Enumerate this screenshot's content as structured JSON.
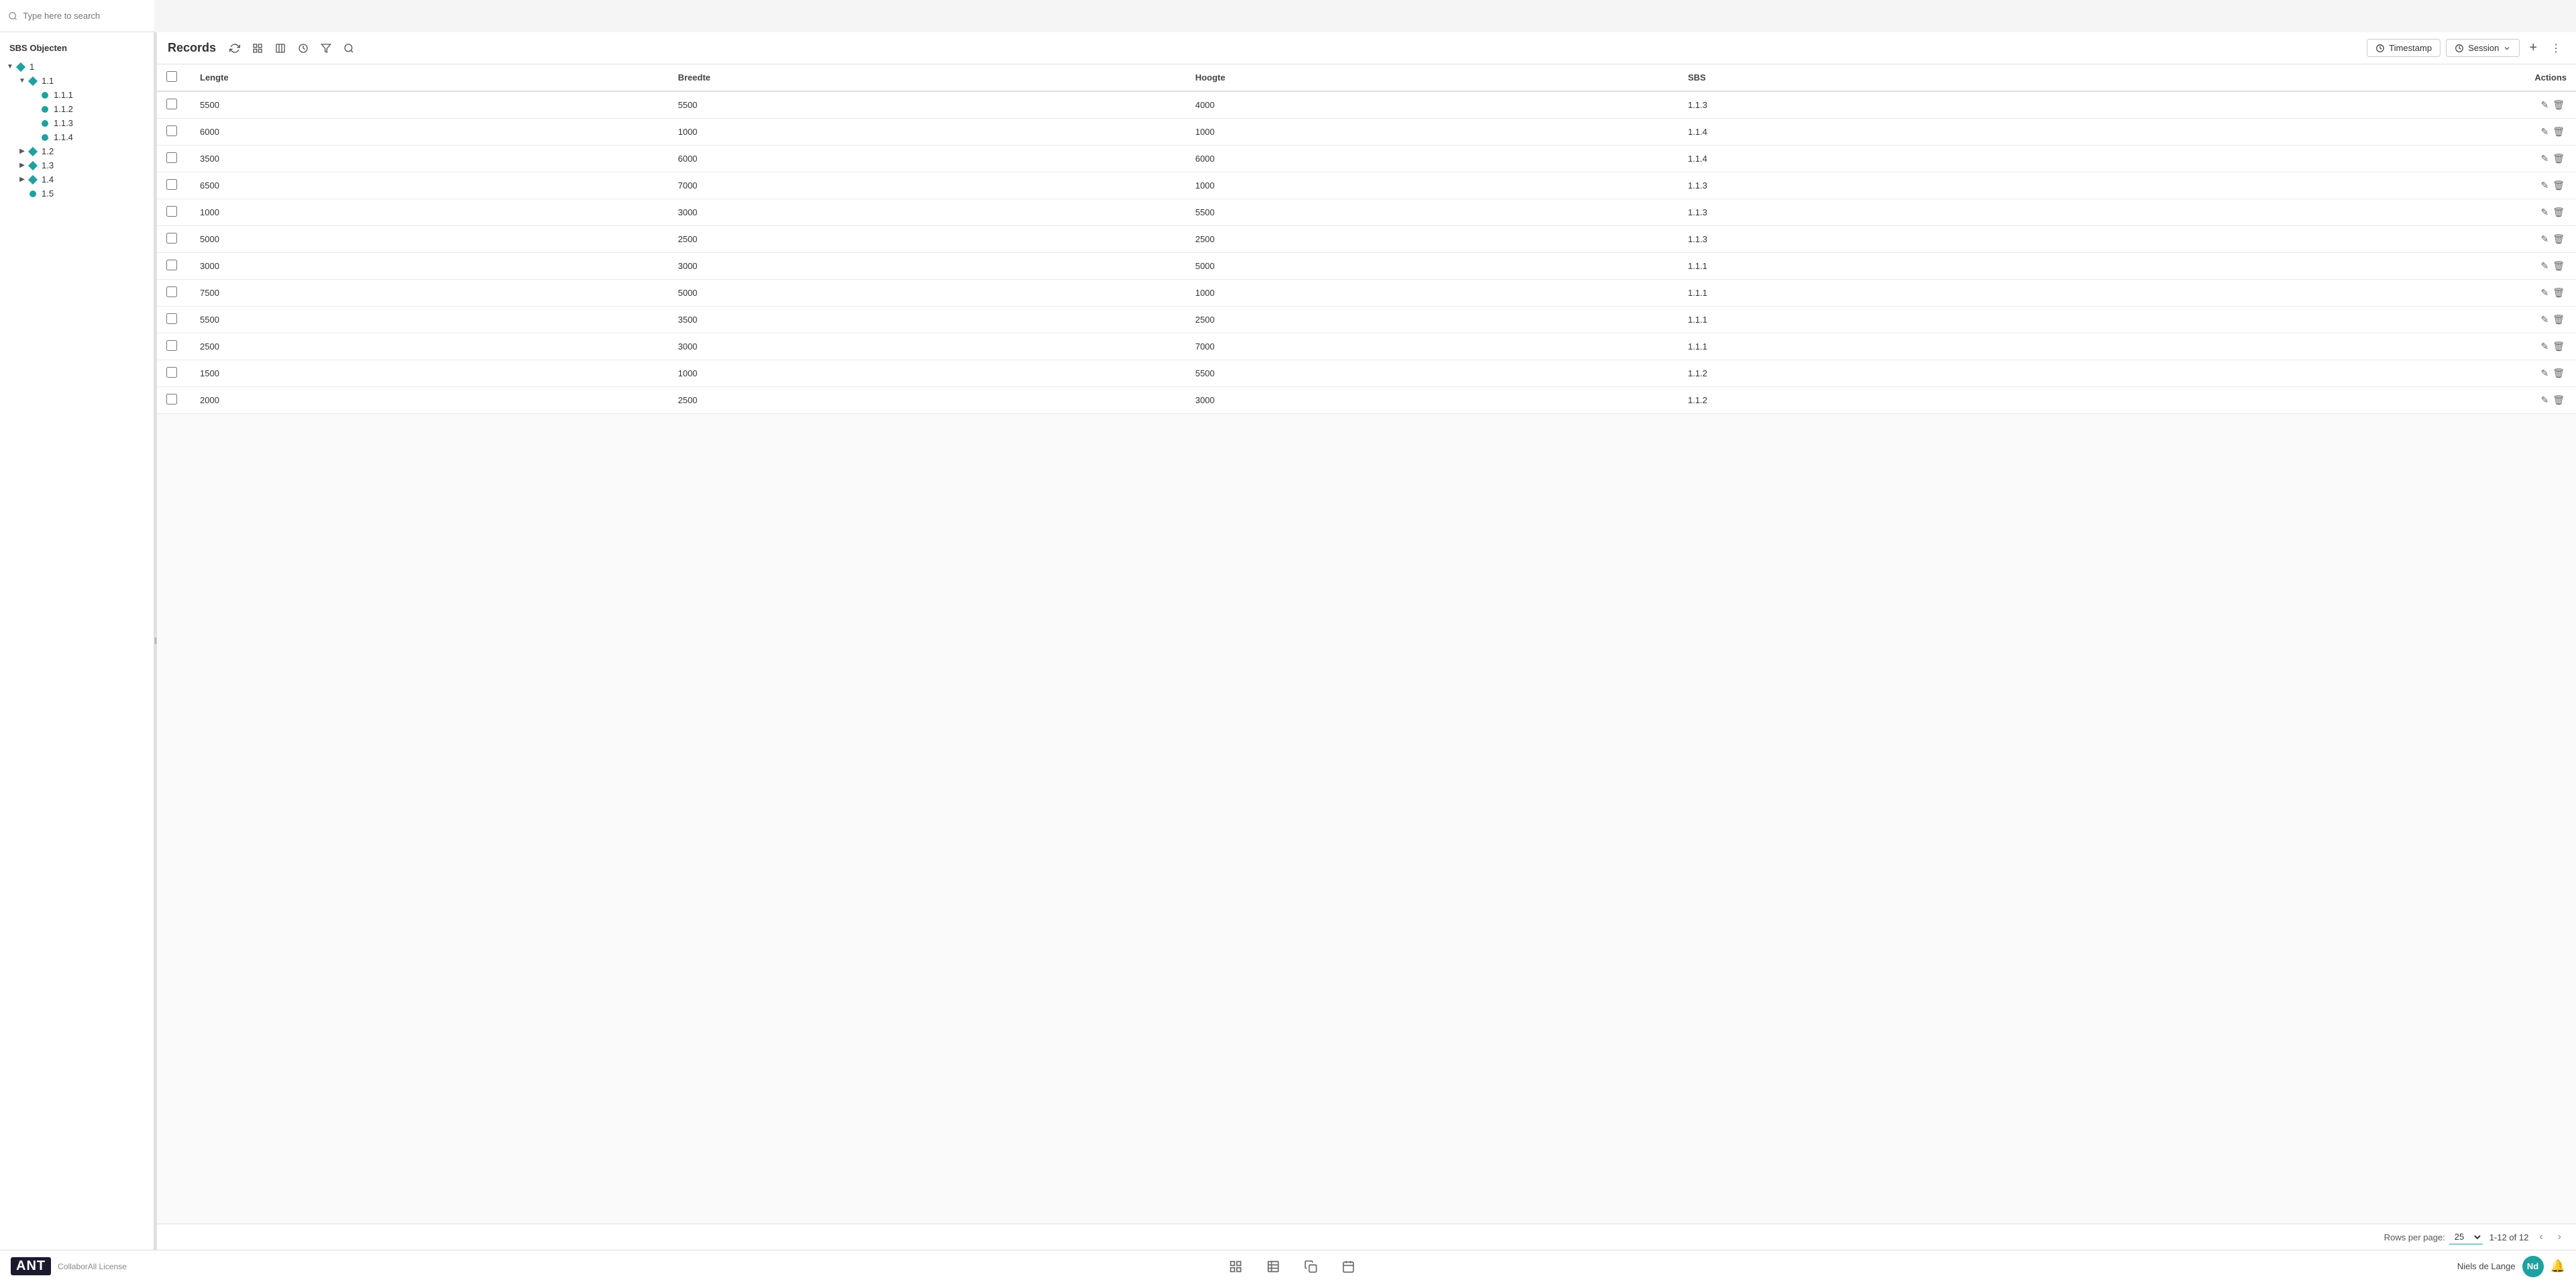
{
  "search": {
    "placeholder": "Type here to search"
  },
  "sidebar": {
    "title": "SBS Objecten",
    "tree": [
      {
        "id": "1",
        "label": "1",
        "level": 0,
        "type": "diamond",
        "expanded": true,
        "chevron": "▼"
      },
      {
        "id": "1.1",
        "label": "1.1",
        "level": 1,
        "type": "diamond",
        "expanded": true,
        "chevron": "▼"
      },
      {
        "id": "1.1.1",
        "label": "1.1.1",
        "level": 2,
        "type": "dot"
      },
      {
        "id": "1.1.2",
        "label": "1.1.2",
        "level": 2,
        "type": "dot"
      },
      {
        "id": "1.1.3",
        "label": "1.1.3",
        "level": 2,
        "type": "dot"
      },
      {
        "id": "1.1.4",
        "label": "1.1.4",
        "level": 2,
        "type": "dot"
      },
      {
        "id": "1.2",
        "label": "1.2",
        "level": 1,
        "type": "diamond",
        "collapsed": true,
        "chevron": "▶"
      },
      {
        "id": "1.3",
        "label": "1.3",
        "level": 1,
        "type": "diamond",
        "collapsed": true,
        "chevron": "▶"
      },
      {
        "id": "1.4",
        "label": "1.4",
        "level": 1,
        "type": "diamond",
        "collapsed": true,
        "chevron": "▶"
      },
      {
        "id": "1.5",
        "label": "1.5",
        "level": 1,
        "type": "dot"
      }
    ]
  },
  "records": {
    "title": "Records",
    "timestamp_label": "Timestamp",
    "session_label": "Session",
    "columns": [
      "Lengte",
      "Breedte",
      "Hoogte",
      "SBS",
      "Actions"
    ],
    "rows": [
      {
        "lengte": "5500",
        "breedte": "5500",
        "hoogte": "4000",
        "sbs": "1.1.3"
      },
      {
        "lengte": "6000",
        "breedte": "1000",
        "hoogte": "1000",
        "sbs": "1.1.4"
      },
      {
        "lengte": "3500",
        "breedte": "6000",
        "hoogte": "6000",
        "sbs": "1.1.4"
      },
      {
        "lengte": "6500",
        "breedte": "7000",
        "hoogte": "1000",
        "sbs": "1.1.3"
      },
      {
        "lengte": "1000",
        "breedte": "3000",
        "hoogte": "5500",
        "sbs": "1.1.3"
      },
      {
        "lengte": "5000",
        "breedte": "2500",
        "hoogte": "2500",
        "sbs": "1.1.3"
      },
      {
        "lengte": "3000",
        "breedte": "3000",
        "hoogte": "5000",
        "sbs": "1.1.1"
      },
      {
        "lengte": "7500",
        "breedte": "5000",
        "hoogte": "1000",
        "sbs": "1.1.1"
      },
      {
        "lengte": "5500",
        "breedte": "3500",
        "hoogte": "2500",
        "sbs": "1.1.1"
      },
      {
        "lengte": "2500",
        "breedte": "3000",
        "hoogte": "7000",
        "sbs": "1.1.1"
      },
      {
        "lengte": "1500",
        "breedte": "1000",
        "hoogte": "5500",
        "sbs": "1.1.2"
      },
      {
        "lengte": "2000",
        "breedte": "2500",
        "hoogte": "3000",
        "sbs": "1.1.2"
      }
    ],
    "pagination": {
      "rows_per_page_label": "Rows per page:",
      "rows_per_page_value": "25",
      "range": "1-12 of 12"
    }
  },
  "bottom_bar": {
    "logo": "ANT",
    "license": "CollaborAll License",
    "user_name": "Niels de Lange",
    "avatar_initials": "Nd"
  }
}
